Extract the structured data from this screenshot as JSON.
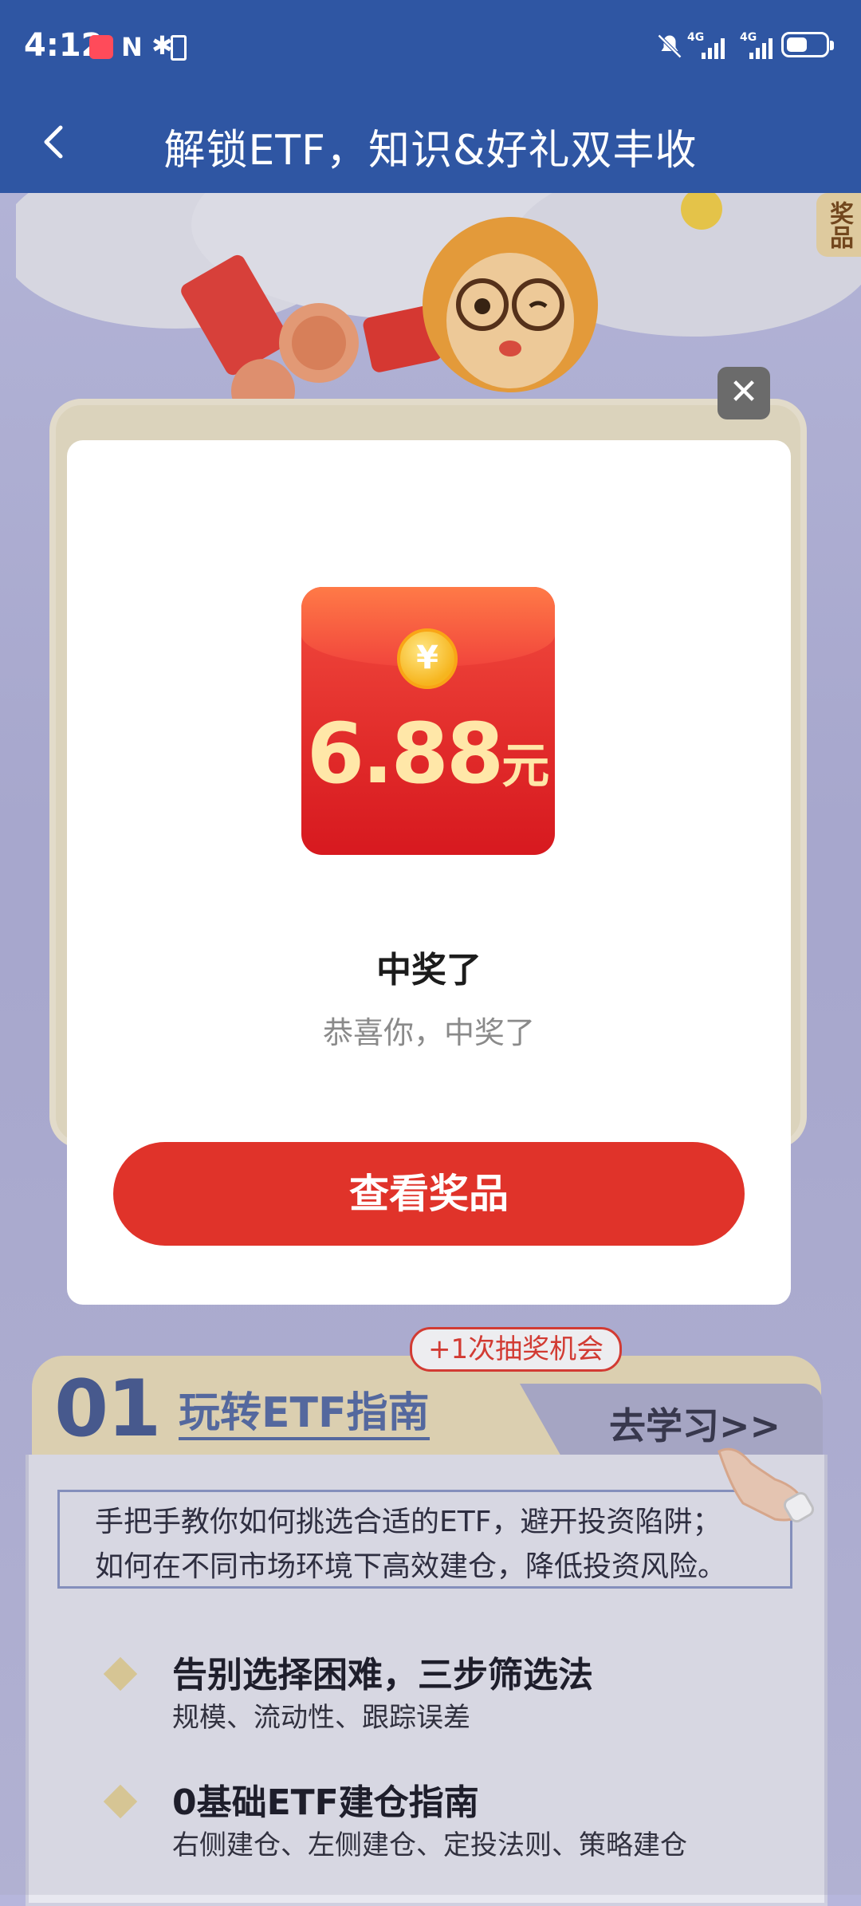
{
  "status_bar": {
    "time": "4:12",
    "nfc_label": "N",
    "network_1": "4G",
    "network_2": "4G",
    "battery_level": 0.55
  },
  "header": {
    "title": "解锁ETF，知识&好礼双丰收",
    "back_icon": "chevron-left-icon"
  },
  "side_tab": {
    "label": "奖品"
  },
  "modal": {
    "envelope": {
      "coin_symbol": "¥",
      "amount": "6.88",
      "unit": "元"
    },
    "title": "中奖了",
    "subtitle": "恭喜你，中奖了",
    "primary_button": "查看奖品",
    "close_icon": "close-icon",
    "close_symbol": "✕"
  },
  "section": {
    "number": "01",
    "name": "玩转ETF指南",
    "bonus_badge": "+1次抽奖机会",
    "go_link": "去学习>>",
    "description_line1": "手把手教你如何挑选合适的ETF，避开投资陷阱；",
    "description_line2": "如何在不同市场环境下高效建仓，降低投资风险。",
    "items": [
      {
        "title": "告别选择困难，三步筛选法",
        "subtitle": "规模、流动性、跟踪误差"
      },
      {
        "title": "0基础ETF建仓指南",
        "subtitle": "右侧建仓、左侧建仓、定投法则、策略建仓"
      }
    ]
  },
  "colors": {
    "header_bg": "#2f56a3",
    "primary_red": "#e0332a",
    "page_bg": "#b6b6dc",
    "accent_gold": "#ecdfba"
  }
}
